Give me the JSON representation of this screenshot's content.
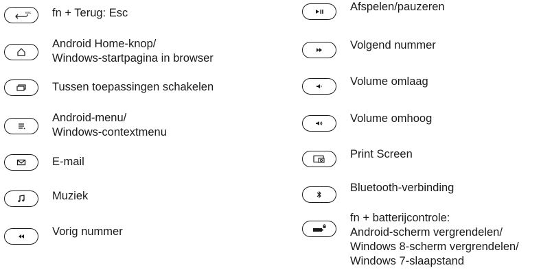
{
  "left": [
    {
      "icon": "back-esc-icon",
      "label": "fn + Terug: Esc"
    },
    {
      "icon": "home-icon",
      "label": "Android Home-knop/\nWindows-startpagina in browser"
    },
    {
      "icon": "switch-apps-icon",
      "label": "Tussen toepassingen schakelen"
    },
    {
      "icon": "menu-icon",
      "label": "Android-menu/\nWindows-contextmenu"
    },
    {
      "icon": "email-icon",
      "label": "E-mail"
    },
    {
      "icon": "music-icon",
      "label": "Muziek"
    },
    {
      "icon": "previous-track-icon",
      "label": "Vorig nummer"
    }
  ],
  "right": [
    {
      "icon": "play-pause-icon",
      "label": "Afspelen/pauzeren"
    },
    {
      "icon": "next-track-icon",
      "label": "Volgend nummer"
    },
    {
      "icon": "volume-down-icon",
      "label": "Volume omlaag"
    },
    {
      "icon": "volume-up-icon",
      "label": "Volume omhoog"
    },
    {
      "icon": "print-screen-icon",
      "label": "Print Screen"
    },
    {
      "icon": "bluetooth-icon",
      "label": "Bluetooth-verbinding"
    },
    {
      "icon": "battery-lock-icon",
      "label": "fn + batterijcontrole:\nAndroid-scherm vergrendelen/\nWindows 8-scherm vergrendelen/\nWindows 7-slaapstand"
    }
  ]
}
